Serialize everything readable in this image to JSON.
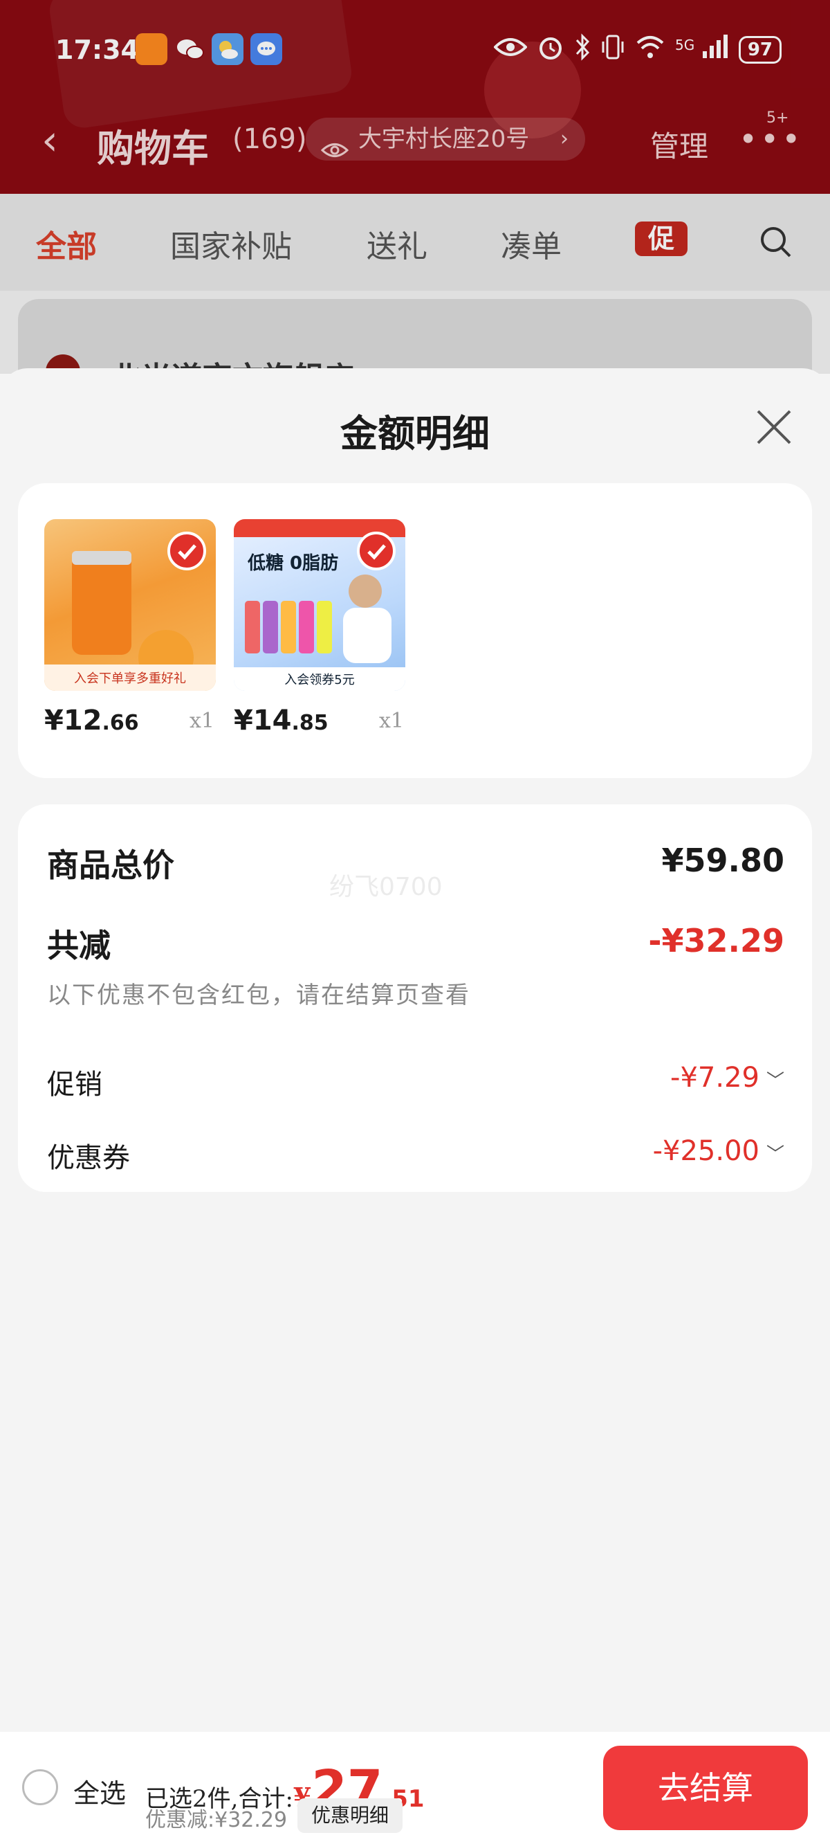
{
  "status_bar": {
    "time": "17:34",
    "battery": "97",
    "network": "5G"
  },
  "nav": {
    "title": "购物车",
    "count": "(169)",
    "address": "大宇村长座20号",
    "manage": "管理",
    "more_badge": "5+"
  },
  "tabs": [
    {
      "label": "全部",
      "active": true
    },
    {
      "label": "国家补贴",
      "active": false
    },
    {
      "label": "送礼",
      "active": false
    },
    {
      "label": "凑单",
      "active": false
    }
  ],
  "promo_tag": "促",
  "background_shop": "北光道宏文旗舰店 >",
  "sheet": {
    "title": "金额明细",
    "products": [
      {
        "price_int": "¥12",
        "price_dec": ".66",
        "qty": "x1",
        "thumb_caption": "入会下单享多重好礼"
      },
      {
        "price_int": "¥14",
        "price_dec": ".85",
        "qty": "x1",
        "thumb_caption": "入会领券5元",
        "thumb_text": "低糖 0脂肪"
      }
    ],
    "watermark": "纷飞0700",
    "summary": {
      "total_label": "商品总价",
      "total_value": "¥59.80",
      "reduce_label": "共减",
      "reduce_value": "-¥32.29",
      "note": "以下优惠不包含红包，请在结算页查看",
      "promo_label": "促销",
      "promo_value": "-¥7.29",
      "coupon_label": "优惠券",
      "coupon_value": "-¥25.00"
    }
  },
  "bottom": {
    "select_all": "全选",
    "selected_text": "已选2件,合计:",
    "total_yen": "¥",
    "total_int": "27",
    "total_dec": ".51",
    "discount": "优惠减:¥32.29",
    "detail_button": "优惠明细",
    "checkout": "去结算"
  },
  "colors": {
    "accent_red": "#e0302a",
    "header_red": "#8a0a12",
    "checkout_red": "#f03a3c"
  }
}
